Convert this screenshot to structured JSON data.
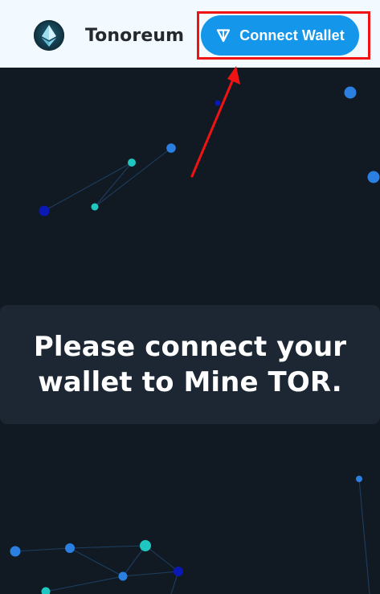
{
  "app": {
    "brand": "Tonoreum"
  },
  "header": {
    "connect_wallet_label": "Connect Wallet",
    "connect_wallet_icon": "ton-diamond-icon",
    "logo_icon": "ethereum-diamond-icon"
  },
  "main": {
    "message": "Please connect your\nwallet to Mine TOR."
  },
  "annotation": {
    "highlight_color": "#f01313",
    "arrow_color": "#f01313"
  },
  "colors": {
    "background": "#111923",
    "header_background": "#f2faff",
    "button_blue": "#1496ea",
    "card_background": "#1d2733",
    "node_teal": "#20c7c0",
    "node_blue": "#2b7fe0",
    "node_dark_blue": "#0a18b5"
  }
}
